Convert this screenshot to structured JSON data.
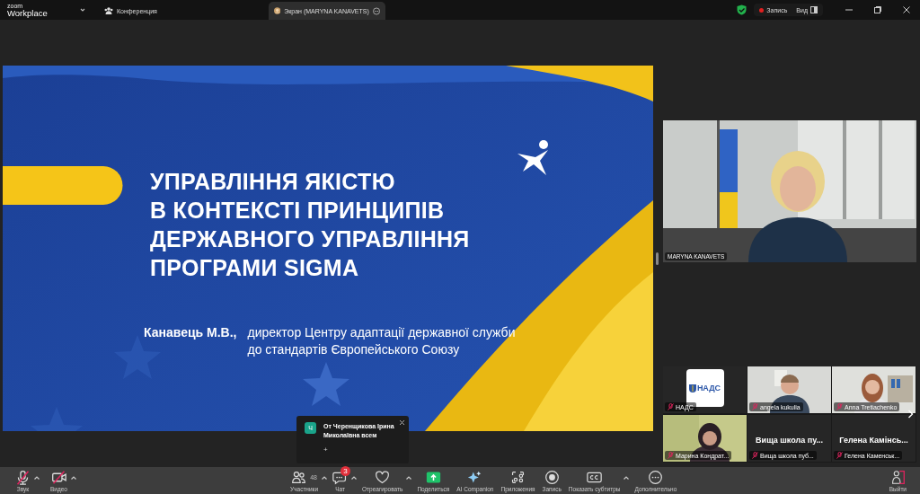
{
  "title_bar": {
    "logo_small": "zoom",
    "logo": "Workplace",
    "tabs": [
      {
        "label": "Конференция",
        "kind": "meeting",
        "selected": false
      },
      {
        "label": "Экран (MARYNA KANAVETS)",
        "kind": "screen",
        "selected": true
      }
    ],
    "recording": "Запись",
    "view": "Вид"
  },
  "slide": {
    "title_lines": [
      "УПРАВЛІННЯ ЯКІСТЮ",
      "В КОНТЕКСТІ ПРИНЦИПІВ",
      "ДЕРЖАВНОГО УПРАВЛІННЯ",
      "ПРОГРАМИ SIGMA"
    ],
    "author": "Канавець М.В.,",
    "position_lines": [
      "директор Центру адаптації державної служби",
      "до стандартів Європейського Союзу"
    ]
  },
  "speaker": {
    "name": "MARYNA KANAVETS"
  },
  "gallery": [
    {
      "kind": "logo",
      "logo_text": "НАДС",
      "name": "НАДС",
      "muted": true
    },
    {
      "kind": "video",
      "name": "angela kukulia",
      "muted": true
    },
    {
      "kind": "video",
      "name": "Anna Tretiachenko",
      "muted": true
    },
    {
      "kind": "video",
      "name": "Марина Кондрат...",
      "muted": true
    },
    {
      "kind": "no_video",
      "display_name": "Вища школа пу...",
      "name": "Вища школа пуб...",
      "muted": true
    },
    {
      "kind": "no_video",
      "display_name": "Гелена Камінсь...",
      "name": "Гелена Каменськ...",
      "muted": true
    }
  ],
  "chat_notification": {
    "avatar": "Ч",
    "message": "От Черенщикова Ірина Миколаївна всем",
    "action": "+"
  },
  "toolbar": [
    {
      "label": "Звук",
      "kind": "mic-off",
      "caret": true
    },
    {
      "label": "Видео",
      "kind": "video-off",
      "caret": true
    },
    {
      "label": "Участники",
      "kind": "participants",
      "count": "48",
      "caret": true
    },
    {
      "label": "Чат",
      "kind": "chat",
      "badge": "3",
      "caret": true
    },
    {
      "label": "Отреагировать",
      "kind": "heart",
      "caret": true
    },
    {
      "label": "Поделиться",
      "kind": "share",
      "caret": false
    },
    {
      "label": "AI Companion",
      "kind": "sparkle",
      "caret": false
    },
    {
      "label": "Приложения",
      "kind": "apps",
      "caret": false
    },
    {
      "label": "Запись",
      "kind": "record",
      "caret": false
    },
    {
      "label": "Показать субтитры",
      "kind": "cc",
      "caret": true
    },
    {
      "label": "Дополнительно",
      "kind": "more",
      "caret": false
    }
  ],
  "leave": {
    "label": "Выйти"
  }
}
